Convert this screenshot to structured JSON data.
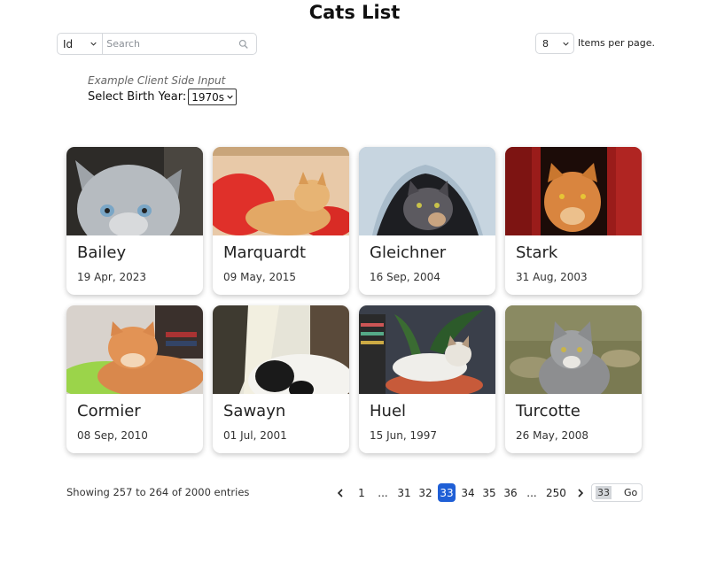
{
  "page": {
    "title": "Cats List"
  },
  "search": {
    "field": "Id",
    "placeholder": "Search"
  },
  "items_per_page": {
    "value": "8",
    "label": "Items per page."
  },
  "example": {
    "label": "Example Client Side Input",
    "birth_label": "Select Birth Year:",
    "birth_value": "1970s"
  },
  "cats": [
    {
      "name": "Bailey",
      "date": "19 Apr, 2023"
    },
    {
      "name": "Marquardt",
      "date": "09 May, 2015"
    },
    {
      "name": "Gleichner",
      "date": "16 Sep, 2004"
    },
    {
      "name": "Stark",
      "date": "31 Aug, 2003"
    },
    {
      "name": "Cormier",
      "date": "08 Sep, 2010"
    },
    {
      "name": "Sawayn",
      "date": "01 Jul, 2001"
    },
    {
      "name": "Huel",
      "date": "15 Jun, 1997"
    },
    {
      "name": "Turcotte",
      "date": "26 May, 2008"
    }
  ],
  "pagination": {
    "showing": "Showing 257 to 264 of 2000 entries",
    "pages": [
      "1",
      "...",
      "31",
      "32",
      "33",
      "34",
      "35",
      "36",
      "...",
      "250"
    ],
    "current": "33",
    "goto_value": "33",
    "goto_label": "Go"
  }
}
